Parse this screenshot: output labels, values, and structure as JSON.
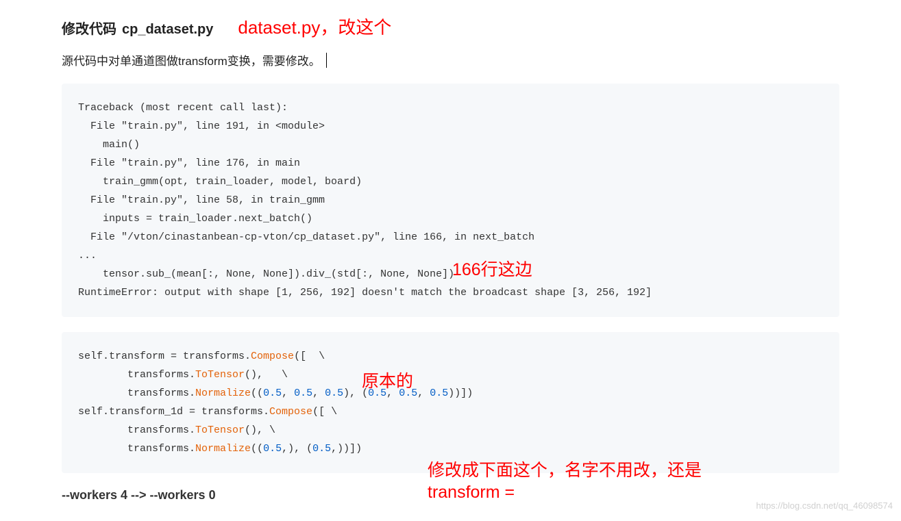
{
  "heading": {
    "prefix": "修改代码",
    "filename": "cp_dataset.py"
  },
  "annotations": {
    "a1": "dataset.py，改这个",
    "a2": "166行这边",
    "a3": "原本的",
    "a4_line1": "修改成下面这个，名字不用改，还是",
    "a4_line2": "transform ="
  },
  "description": "源代码中对单通道图做transform变换，需要修改。",
  "code1": {
    "l1": "Traceback (most recent call last):",
    "l2": "  File \"train.py\", line 191, in <module>",
    "l3": "    main()",
    "l4": "  File \"train.py\", line 176, in main",
    "l5": "    train_gmm(opt, train_loader, model, board)",
    "l6": "  File \"train.py\", line 58, in train_gmm",
    "l7": "    inputs = train_loader.next_batch()",
    "l8": "  File \"/vton/cinastanbean-cp-vton/cp_dataset.py\", line 166, in next_batch",
    "l9": "...",
    "l10": "    tensor.sub_(mean[:, None, None]).div_(std[:, None, None])",
    "l11": "RuntimeError: output with shape [1, 256, 192] doesn't match the broadcast shape [3, 256, 192]"
  },
  "code2": {
    "p1": "self.transform = transforms.",
    "compose1": "Compose",
    "p1b": "([  \\",
    "p2": "        transforms.",
    "totensor1": "ToTensor",
    "p2b": "(),   \\",
    "p3": "        transforms.",
    "normalize1": "Normalize",
    "p3b": "((",
    "n05": "0.5",
    "comma": ", ",
    "p3c": "), (",
    "p3d": "))])",
    "p4": "self.transform_1d = transforms.",
    "compose2": "Compose",
    "p4b": "([ \\",
    "p5": "        transforms.",
    "totensor2": "ToTensor",
    "p5b": "(), \\",
    "p6": "        transforms.",
    "normalize2": "Normalize",
    "p6b": "((",
    "p6c": ",), (",
    "p6d": ",))])"
  },
  "bottom": "--workers 4 --> --workers 0",
  "watermark": "https://blog.csdn.net/qq_46098574"
}
